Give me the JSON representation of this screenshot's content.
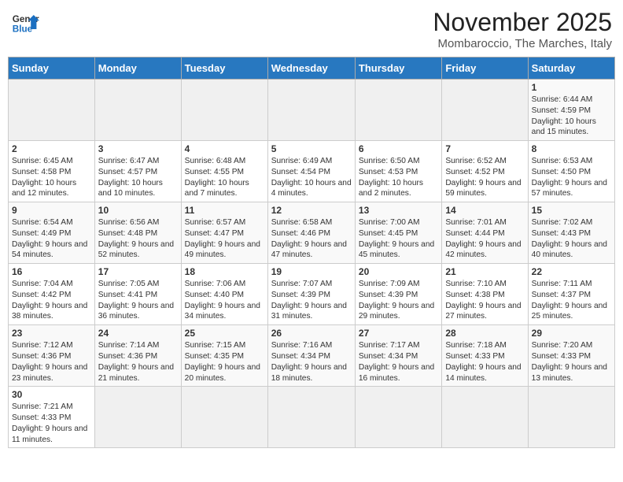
{
  "header": {
    "logo_general": "General",
    "logo_blue": "Blue",
    "month_title": "November 2025",
    "subtitle": "Mombaroccio, The Marches, Italy"
  },
  "weekdays": [
    "Sunday",
    "Monday",
    "Tuesday",
    "Wednesday",
    "Thursday",
    "Friday",
    "Saturday"
  ],
  "weeks": [
    [
      {
        "day": "",
        "content": ""
      },
      {
        "day": "",
        "content": ""
      },
      {
        "day": "",
        "content": ""
      },
      {
        "day": "",
        "content": ""
      },
      {
        "day": "",
        "content": ""
      },
      {
        "day": "",
        "content": ""
      },
      {
        "day": "1",
        "content": "Sunrise: 6:44 AM\nSunset: 4:59 PM\nDaylight: 10 hours and 15 minutes."
      }
    ],
    [
      {
        "day": "2",
        "content": "Sunrise: 6:45 AM\nSunset: 4:58 PM\nDaylight: 10 hours and 12 minutes."
      },
      {
        "day": "3",
        "content": "Sunrise: 6:47 AM\nSunset: 4:57 PM\nDaylight: 10 hours and 10 minutes."
      },
      {
        "day": "4",
        "content": "Sunrise: 6:48 AM\nSunset: 4:55 PM\nDaylight: 10 hours and 7 minutes."
      },
      {
        "day": "5",
        "content": "Sunrise: 6:49 AM\nSunset: 4:54 PM\nDaylight: 10 hours and 4 minutes."
      },
      {
        "day": "6",
        "content": "Sunrise: 6:50 AM\nSunset: 4:53 PM\nDaylight: 10 hours and 2 minutes."
      },
      {
        "day": "7",
        "content": "Sunrise: 6:52 AM\nSunset: 4:52 PM\nDaylight: 9 hours and 59 minutes."
      },
      {
        "day": "8",
        "content": "Sunrise: 6:53 AM\nSunset: 4:50 PM\nDaylight: 9 hours and 57 minutes."
      }
    ],
    [
      {
        "day": "9",
        "content": "Sunrise: 6:54 AM\nSunset: 4:49 PM\nDaylight: 9 hours and 54 minutes."
      },
      {
        "day": "10",
        "content": "Sunrise: 6:56 AM\nSunset: 4:48 PM\nDaylight: 9 hours and 52 minutes."
      },
      {
        "day": "11",
        "content": "Sunrise: 6:57 AM\nSunset: 4:47 PM\nDaylight: 9 hours and 49 minutes."
      },
      {
        "day": "12",
        "content": "Sunrise: 6:58 AM\nSunset: 4:46 PM\nDaylight: 9 hours and 47 minutes."
      },
      {
        "day": "13",
        "content": "Sunrise: 7:00 AM\nSunset: 4:45 PM\nDaylight: 9 hours and 45 minutes."
      },
      {
        "day": "14",
        "content": "Sunrise: 7:01 AM\nSunset: 4:44 PM\nDaylight: 9 hours and 42 minutes."
      },
      {
        "day": "15",
        "content": "Sunrise: 7:02 AM\nSunset: 4:43 PM\nDaylight: 9 hours and 40 minutes."
      }
    ],
    [
      {
        "day": "16",
        "content": "Sunrise: 7:04 AM\nSunset: 4:42 PM\nDaylight: 9 hours and 38 minutes."
      },
      {
        "day": "17",
        "content": "Sunrise: 7:05 AM\nSunset: 4:41 PM\nDaylight: 9 hours and 36 minutes."
      },
      {
        "day": "18",
        "content": "Sunrise: 7:06 AM\nSunset: 4:40 PM\nDaylight: 9 hours and 34 minutes."
      },
      {
        "day": "19",
        "content": "Sunrise: 7:07 AM\nSunset: 4:39 PM\nDaylight: 9 hours and 31 minutes."
      },
      {
        "day": "20",
        "content": "Sunrise: 7:09 AM\nSunset: 4:39 PM\nDaylight: 9 hours and 29 minutes."
      },
      {
        "day": "21",
        "content": "Sunrise: 7:10 AM\nSunset: 4:38 PM\nDaylight: 9 hours and 27 minutes."
      },
      {
        "day": "22",
        "content": "Sunrise: 7:11 AM\nSunset: 4:37 PM\nDaylight: 9 hours and 25 minutes."
      }
    ],
    [
      {
        "day": "23",
        "content": "Sunrise: 7:12 AM\nSunset: 4:36 PM\nDaylight: 9 hours and 23 minutes."
      },
      {
        "day": "24",
        "content": "Sunrise: 7:14 AM\nSunset: 4:36 PM\nDaylight: 9 hours and 21 minutes."
      },
      {
        "day": "25",
        "content": "Sunrise: 7:15 AM\nSunset: 4:35 PM\nDaylight: 9 hours and 20 minutes."
      },
      {
        "day": "26",
        "content": "Sunrise: 7:16 AM\nSunset: 4:34 PM\nDaylight: 9 hours and 18 minutes."
      },
      {
        "day": "27",
        "content": "Sunrise: 7:17 AM\nSunset: 4:34 PM\nDaylight: 9 hours and 16 minutes."
      },
      {
        "day": "28",
        "content": "Sunrise: 7:18 AM\nSunset: 4:33 PM\nDaylight: 9 hours and 14 minutes."
      },
      {
        "day": "29",
        "content": "Sunrise: 7:20 AM\nSunset: 4:33 PM\nDaylight: 9 hours and 13 minutes."
      }
    ],
    [
      {
        "day": "30",
        "content": "Sunrise: 7:21 AM\nSunset: 4:33 PM\nDaylight: 9 hours and 11 minutes."
      },
      {
        "day": "",
        "content": ""
      },
      {
        "day": "",
        "content": ""
      },
      {
        "day": "",
        "content": ""
      },
      {
        "day": "",
        "content": ""
      },
      {
        "day": "",
        "content": ""
      },
      {
        "day": "",
        "content": ""
      }
    ]
  ]
}
